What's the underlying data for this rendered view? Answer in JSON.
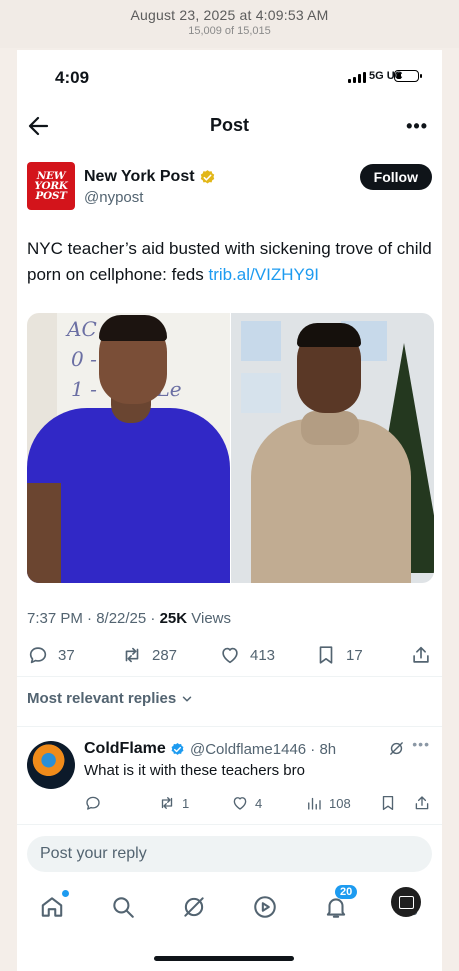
{
  "archive": {
    "date_text": "August 23, 2025 at 4:09:53 AM",
    "count_text": "15,009 of 15,015"
  },
  "status_bar": {
    "time": "4:09",
    "network": "5G UC"
  },
  "topbar": {
    "title": "Post",
    "more": "•••"
  },
  "post": {
    "author_logo_text": "NEW YORK POST",
    "author_name": "New York Post",
    "author_handle": "@nypost",
    "follow_label": "Follow",
    "text": "NYC teacher’s aid busted with sickening trove of child porn on cellphone: feds ",
    "link": "trib.al/VIZHY9I",
    "time": "7:37 PM · 8/22/25 · ",
    "views_count": "25K",
    "views_label": " Views",
    "stats": {
      "replies": "37",
      "reposts": "287",
      "likes": "413",
      "bookmarks": "17"
    }
  },
  "replies_header": "Most relevant replies",
  "reply": {
    "name": "ColdFlame",
    "handle_time": "@Coldflame1446 · 8h",
    "text": "What is it with these teachers bro",
    "more": "•••",
    "reposts": "1",
    "likes": "4",
    "views": "108"
  },
  "compose": {
    "placeholder": "Post your reply"
  },
  "tabbar": {
    "notifications_badge": "20"
  },
  "colors": {
    "accent": "#1d9bf0",
    "brand_red": "#d3141b",
    "verified_gold": "#e2b719"
  }
}
